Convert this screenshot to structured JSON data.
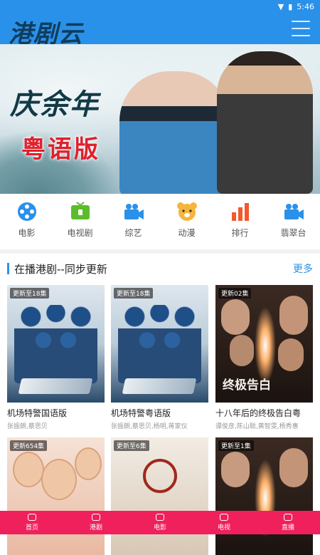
{
  "status": {
    "time": "5:46"
  },
  "app": {
    "logo_text": "港剧云"
  },
  "banner": {
    "title": "庆余年",
    "subtitle": "粤语版"
  },
  "categories": [
    {
      "label": "电影",
      "icon": "film-reel-icon",
      "color": "#2a91ea"
    },
    {
      "label": "电视剧",
      "icon": "tv-icon",
      "color": "#5bbd2b"
    },
    {
      "label": "综艺",
      "icon": "video-camera-icon",
      "color": "#2a91ea"
    },
    {
      "label": "动漫",
      "icon": "bear-face-icon",
      "color": "#f6b53b"
    },
    {
      "label": "排行",
      "icon": "bar-chart-icon",
      "color": "#f05a2c"
    },
    {
      "label": "翡翠台",
      "icon": "video-camera-icon",
      "color": "#2a91ea"
    }
  ],
  "section": {
    "title": "在播港剧--同步更新",
    "more": "更多"
  },
  "cards": [
    {
      "badge": "更新至18集",
      "name": "机场特警国语版",
      "cast": "张振朗,蔡思贝"
    },
    {
      "badge": "更新至18集",
      "name": "机场特警粤语版",
      "cast": "张振朗,蔡思贝,杨明,蒋家仪"
    },
    {
      "badge": "更新02集",
      "name": "十八年后的终极告白粤",
      "cast": "谭俊彦,陈山聪,黄智雯,杨秀惠"
    },
    {
      "badge": "更新654集",
      "name": "",
      "cast": ""
    },
    {
      "badge": "更新至6集",
      "name": "",
      "cast": ""
    },
    {
      "badge": "更新至1集",
      "name": "",
      "cast": ""
    }
  ],
  "poster3_title": "终极告白",
  "tabbar": [
    {
      "label": "首页"
    },
    {
      "label": "港剧"
    },
    {
      "label": "电影"
    },
    {
      "label": "电视"
    },
    {
      "label": "直播"
    }
  ]
}
